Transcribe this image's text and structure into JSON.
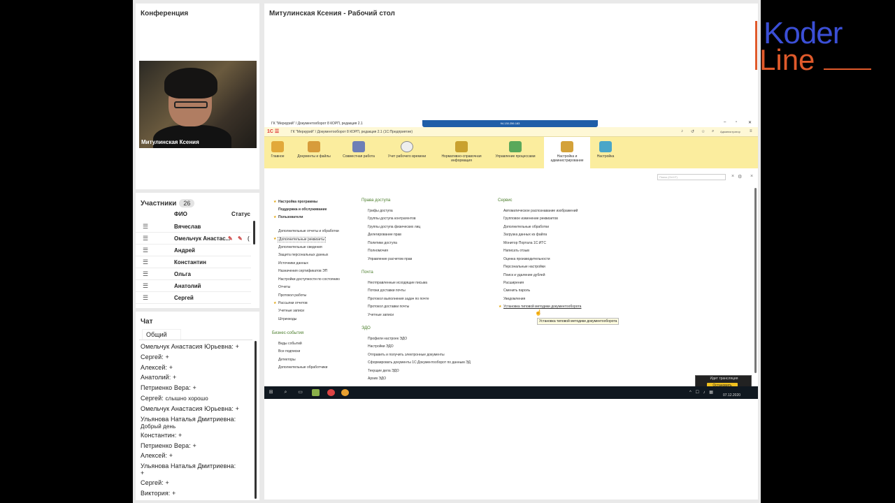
{
  "conference": {
    "title": "Конференция",
    "speaker_name": "Митулинская Ксения"
  },
  "participants": {
    "title": "Участники",
    "count": "26",
    "col_name": "ФИО",
    "col_status": "Статус",
    "rows": [
      "Вячеслав",
      "Омельчук Анастас...",
      "Андрей",
      "Константин",
      "Ольга",
      "Анатолий",
      "Сергей"
    ]
  },
  "chat": {
    "title": "Чат",
    "tab": "Общий",
    "messages": [
      {
        "from": "Омельчук Анастасия Юрьевна:",
        "text": "+"
      },
      {
        "from": "Сергей:",
        "text": "+"
      },
      {
        "from": "Алексей:",
        "text": "+"
      },
      {
        "from": "Анатолий:",
        "text": "+"
      },
      {
        "from": "Петриенко Вера:",
        "text": "+"
      },
      {
        "from": "Сергей:",
        "text": "слышно хорошо"
      },
      {
        "from": "Омельчук Анастасия Юрьевна:",
        "text": "+"
      },
      {
        "from": "Ульянова Наталья Дмитриевна:",
        "text": "Добрый день"
      },
      {
        "from": "Константин:",
        "text": "+"
      },
      {
        "from": "Петриенко Вера:",
        "text": "+"
      },
      {
        "from": "Алексей:",
        "text": "+"
      },
      {
        "from": "Ульянова Наталья Дмитриевна:",
        "text": "+"
      },
      {
        "from": "Сергей:",
        "text": "+"
      },
      {
        "from": "Виктория:",
        "text": "+"
      }
    ]
  },
  "main": {
    "title": "Митулинская Ксения - Рабочий стол"
  },
  "app": {
    "window_title": "ГК \"Меркурий\" / Документооборот 8 КОРП, редакция 2.1",
    "remote_addr": "94.130.256.183",
    "app_title": "ГК \"Меркурий\" / Документооборот 8 КОРП, редакция 2.1 (1С:Предприятие)",
    "user": "Администратор",
    "sections": [
      "Главное",
      "Документы и файлы",
      "Совместная работа",
      "Учет рабочего времени",
      "Нормативно-справочная информация",
      "Управление процессами",
      "Настройка и администрирование",
      "Настройка"
    ],
    "search_placeholder": "Поиск (Ctrl+F)",
    "col1": {
      "items": [
        "Настройка программы",
        "Поддержка и обслуживание",
        "Пользователи",
        "Дополнительные отчеты и обработки",
        "Дополнительные реквизиты",
        "Дополнительные сведения",
        "Защита персональных данных",
        "Источники данных",
        "Назначения сертификатов ЭП",
        "Настройки доступности по состоянию",
        "Отчеты",
        "Протокол работы",
        "Рассылки отчетов",
        "Учетные записи",
        "Штрихкоды"
      ],
      "header2": "Бизнес-события",
      "items2": [
        "Виды событий",
        "Все подписки",
        "Детекторы",
        "Дополнительные обработчики"
      ]
    },
    "col2": {
      "header1": "Права доступа",
      "items1": [
        "Грифы доступа",
        "Группы доступа контрагентов",
        "Группы доступа физических лиц",
        "Делегирование прав",
        "Политики доступа",
        "Полномочия",
        "Управление расчетом прав"
      ],
      "header2": "Почта",
      "items2": [
        "Неотправленные исходящие письма",
        "Потоки доставки почты",
        "Протокол выполнения задач по почте",
        "Протокол доставки почты",
        "Учетные записи"
      ],
      "header3": "ЭДО",
      "items3": [
        "Профили настроек ЭДО",
        "Настройки ЭДО",
        "Отправить и получить электронные документы",
        "Сформировать документы 1С:Документооборот по данным ЭД",
        "Текущие дела ЭДО",
        "Архив ЭДО"
      ]
    },
    "col3": {
      "header1": "Сервис",
      "items1": [
        "Автоматическое распознавание изображений",
        "Групповое изменение реквизитов",
        "Дополнительные обработки",
        "Загрузка данных из файла",
        "Монитор Портала 1С:ИТС",
        "Написать отзыв",
        "Оценка производительности",
        "Персональные настройки",
        "Поиск и удаление дублей",
        "Расширения",
        "Сменить пароль",
        "Уведомления",
        "Установка типовой методики документооборота"
      ]
    },
    "tooltip": "Установка типовой методики документооборота",
    "broadcast_label": "Идет трансляция",
    "broadcast_button": "Остановить",
    "clock_date": "07.12.2020"
  },
  "brand": {
    "line1": "Koder",
    "line2": "Line"
  }
}
